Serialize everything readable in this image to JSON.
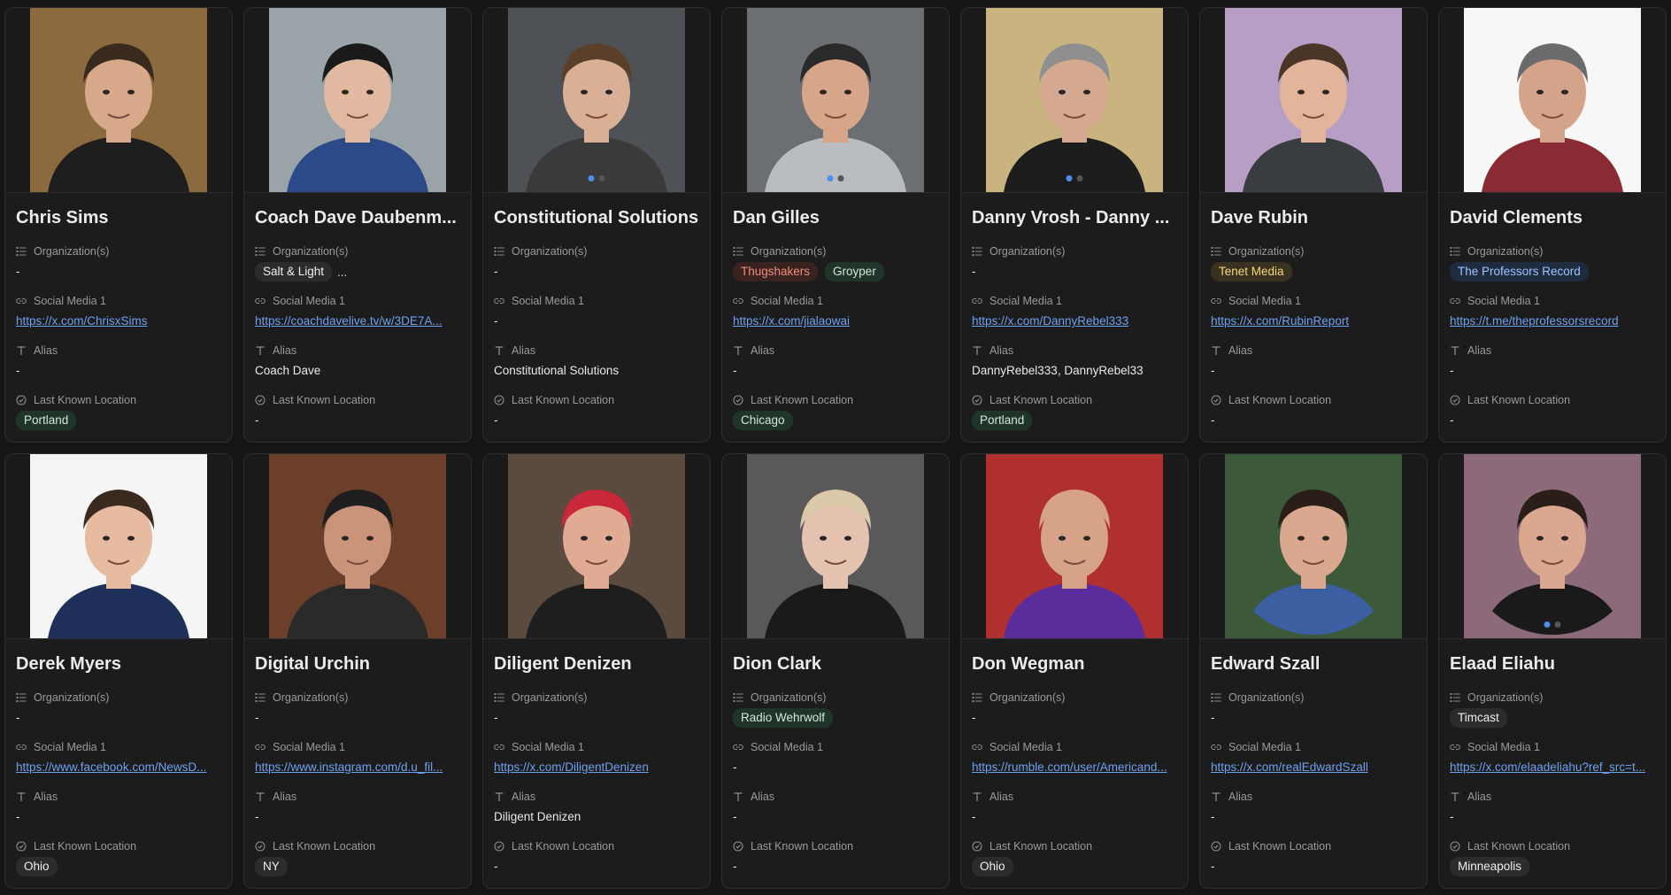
{
  "field_labels": {
    "org": "Organization(s)",
    "social": "Social Media 1",
    "alias": "Alias",
    "location": "Last Known Location"
  },
  "cards": [
    {
      "name": "Chris Sims",
      "orgs": [],
      "social": "https://x.com/ChrisxSims",
      "alias": "-",
      "location": "Portland",
      "skin": "#d7a98a",
      "bg": "#8a6a3e",
      "shirt": "#1e1e1e",
      "hair": "#3a2a1e"
    },
    {
      "name": "Coach Dave Daubenm...",
      "orgs": [
        {
          "label": "Salt & Light",
          "color": "gray"
        }
      ],
      "orgs_more": "...",
      "social": "https://coachdavelive.tv/w/3DE7A...",
      "alias": "Coach Dave",
      "location": "-",
      "skin": "#e0b9a0",
      "bg": "#9aa3a8",
      "shirt": "#2c4a8a",
      "hair": "#1a1a1a"
    },
    {
      "name": "Constitutional Solutions",
      "orgs": [],
      "social": "-",
      "alias": "Constitutional Solutions",
      "location": "-",
      "skin": "#d9b096",
      "bg": "#4e5257",
      "shirt": "#3a3a3a",
      "hair": "#5a3f2a",
      "dots": [
        true,
        false
      ]
    },
    {
      "name": "Dan Gilles",
      "orgs": [
        {
          "label": "Thugshakers",
          "color": "red"
        },
        {
          "label": "Groyper",
          "color": "green"
        }
      ],
      "social": "https://x.com/jialaowai",
      "alias": "-",
      "location": "Chicago",
      "skin": "#d7a688",
      "bg": "#6b6e72",
      "shirt": "#b9bcc0",
      "hair": "#2a2a2a",
      "dots": [
        true,
        false
      ]
    },
    {
      "name": "Danny Vrosh - Danny ...",
      "orgs": [],
      "social": "https://x.com/DannyRebel333",
      "alias": "DannyRebel333, DannyRebel33",
      "location": "Portland",
      "skin": "#d4a98f",
      "bg": "#c9b480",
      "shirt": "#1d1d1d",
      "hair": "#8f8f8f",
      "dots": [
        true,
        false
      ]
    },
    {
      "name": "Dave Rubin",
      "orgs": [
        {
          "label": "Tenet Media",
          "color": "yellow"
        }
      ],
      "social": "https://x.com/RubinReport",
      "alias": "-",
      "location": "-",
      "skin": "#e2b49a",
      "bg": "#b69ec4",
      "shirt": "#3a3d40",
      "hair": "#4a3526"
    },
    {
      "name": "David Clements",
      "orgs": [
        {
          "label": "The Professors Record",
          "color": "blue"
        }
      ],
      "social": "https://t.me/theprofessorsrecord",
      "alias": "-",
      "location": "-",
      "skin": "#d4a48a",
      "bg": "#f7f7f7",
      "shirt": "#8a2a34",
      "hair": "#6b6b6b"
    },
    {
      "name": "Derek Myers",
      "orgs": [],
      "social": "https://www.facebook.com/NewsD...",
      "alias": "-",
      "location": "Ohio",
      "skin": "#e7bba0",
      "bg": "#f5f5f5",
      "shirt": "#1e2f5a",
      "hair": "#3a2a20"
    },
    {
      "name": "Digital Urchin",
      "orgs": [],
      "social": "https://www.instagram.com/d.u_fil...",
      "alias": "-",
      "location": "NY",
      "skin": "#c99479",
      "bg": "#6b3f2a",
      "shirt": "#2a2a2a",
      "hair": "#1f1f1f"
    },
    {
      "name": "Diligent Denizen",
      "orgs": [],
      "social": "https://x.com/DiligentDenizen",
      "alias": "Diligent Denizen",
      "location": "-",
      "skin": "#e0ab92",
      "bg": "#5b4a3e",
      "shirt": "#1e1e1e",
      "hair": "#c8283a"
    },
    {
      "name": "Dion Clark",
      "orgs": [
        {
          "label": "Radio Wehrwolf",
          "color": "green"
        }
      ],
      "social": "-",
      "alias": "-",
      "location": "-",
      "skin": "#e5c3b0",
      "bg": "#595959",
      "shirt": "#1a1a1a",
      "hair": "#d9c9a8"
    },
    {
      "name": "Don Wegman",
      "orgs": [],
      "social": "https://rumble.com/user/Americand...",
      "alias": "-",
      "location": "Ohio",
      "skin": "#d6a288",
      "bg": "#b03030",
      "shirt": "#5b2d9c",
      "hair": "#d6a288"
    },
    {
      "name": "Edward Szall",
      "orgs": [],
      "social": "https://x.com/realEdwardSzall",
      "alias": "-",
      "location": "-",
      "skin": "#d9a88e",
      "bg": "#3c5a3a",
      "shirt": "#3b5fa0",
      "hair": "#2a1e18",
      "round": true
    },
    {
      "name": "Elaad Eliahu",
      "orgs": [
        {
          "label": "Timcast",
          "color": "gray"
        }
      ],
      "social": "https://x.com/elaadeliahu?ref_src=t...",
      "alias": "-",
      "location": "Minneapolis",
      "skin": "#d9a88e",
      "bg": "#8c6a7a",
      "shirt": "#1a1a1a",
      "hair": "#2a1e18",
      "round": true,
      "dots": [
        true,
        false
      ]
    }
  ]
}
